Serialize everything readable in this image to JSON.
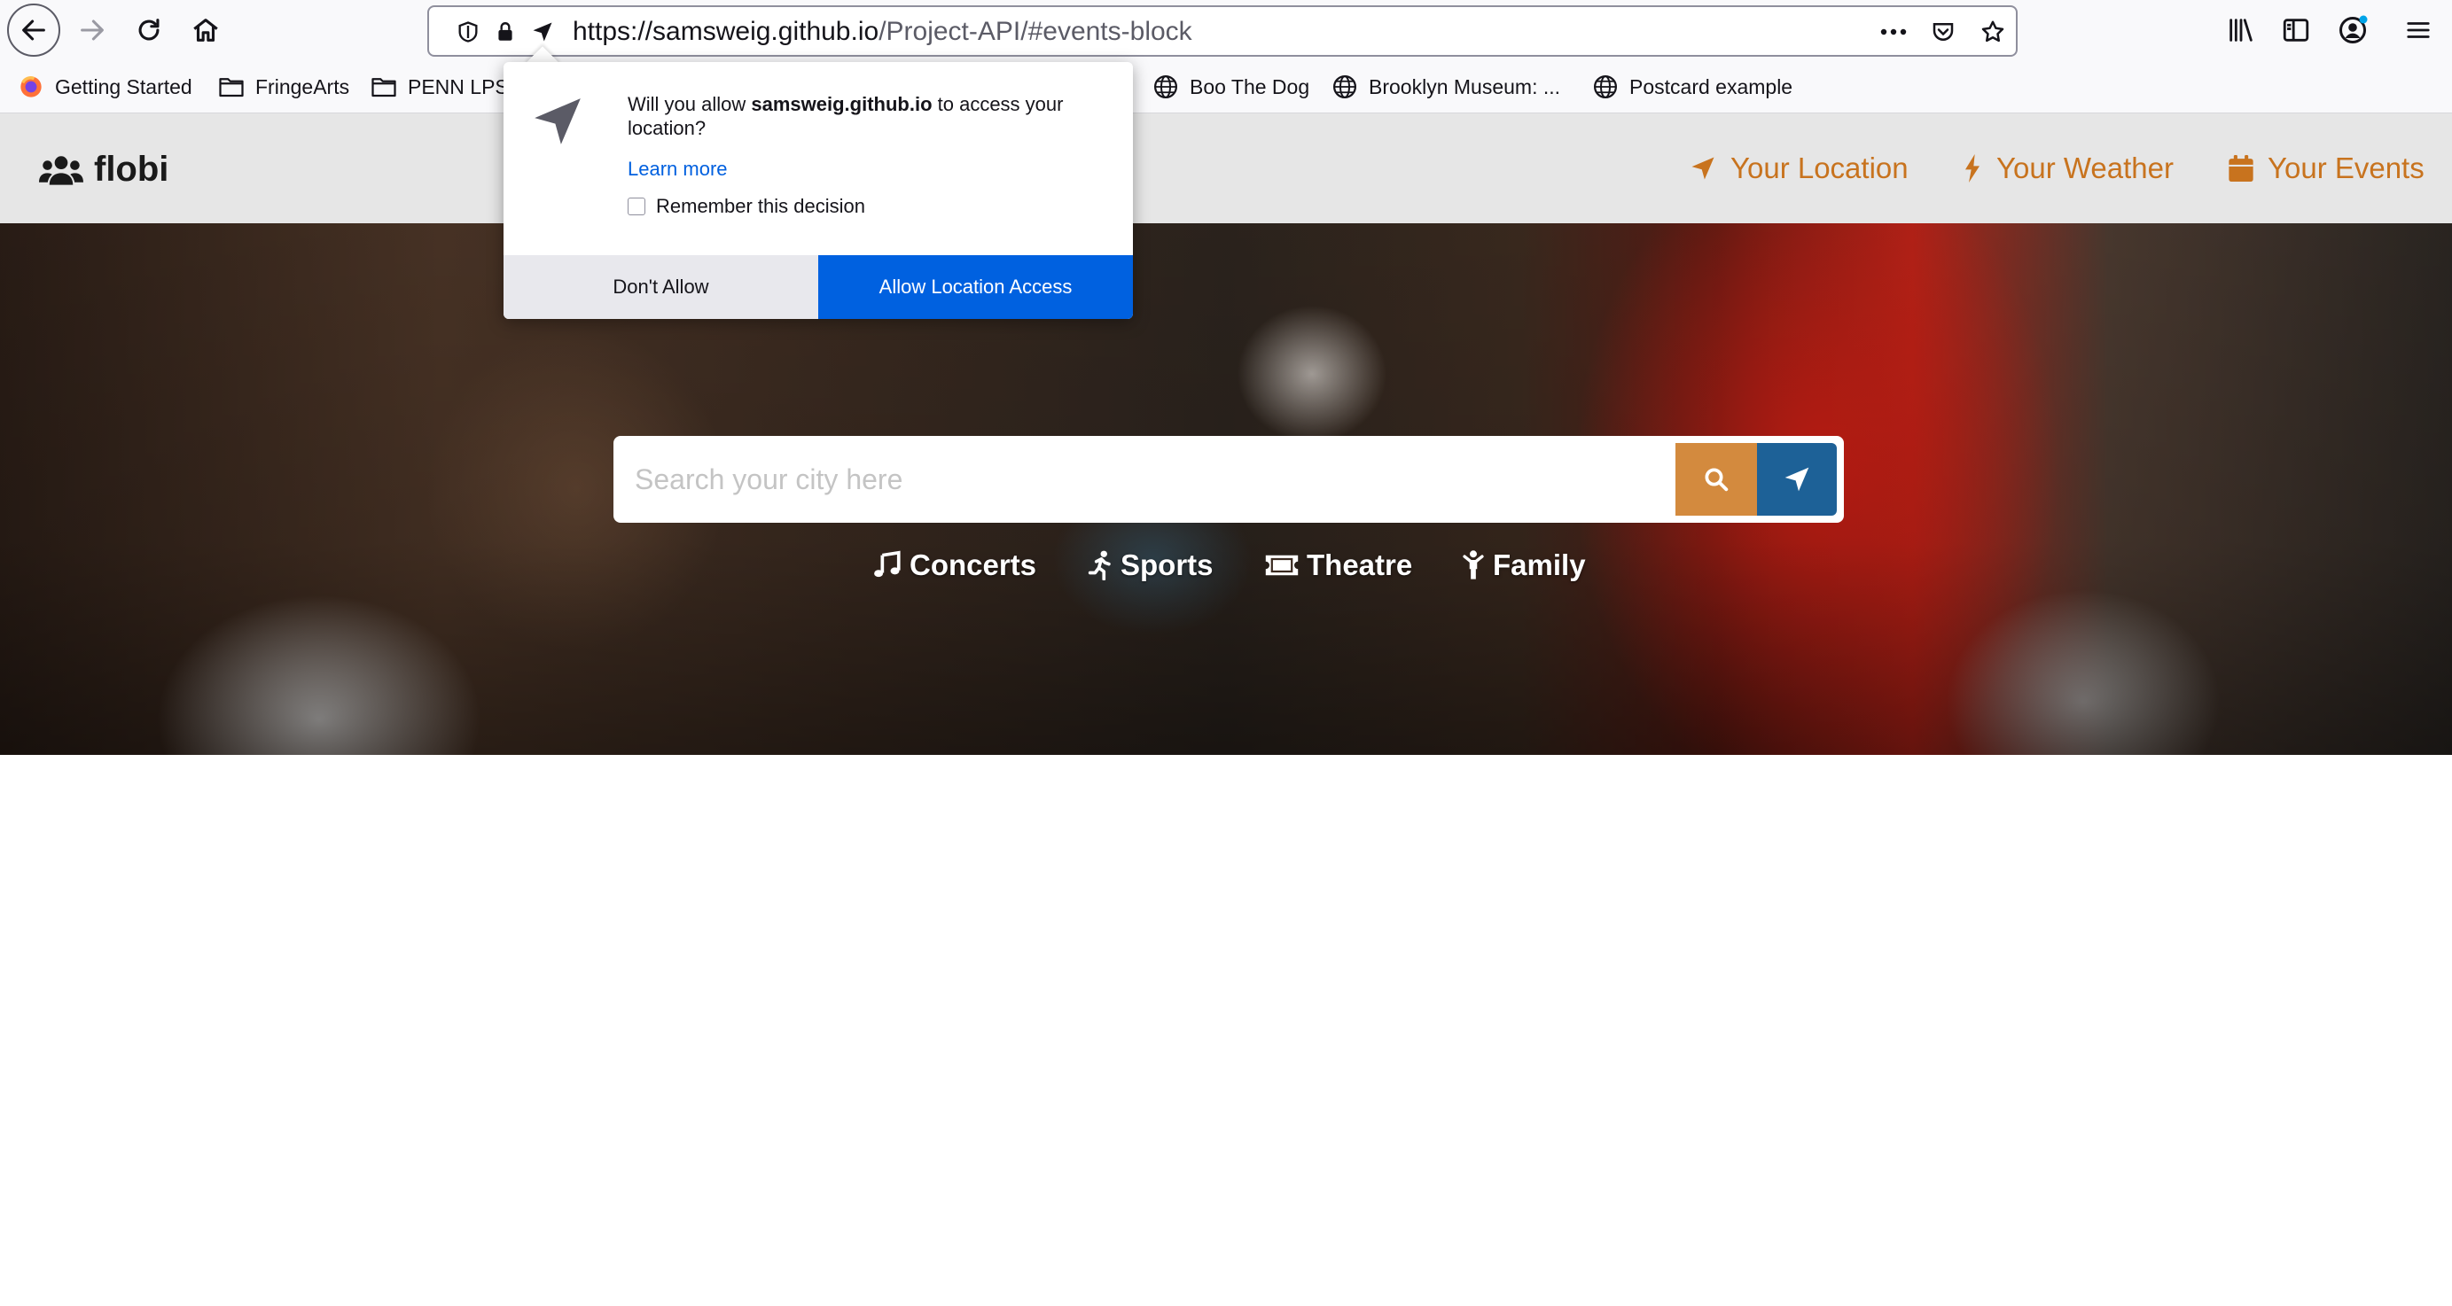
{
  "browser": {
    "url_host": "https://samsweig.github.io",
    "url_path": "/Project-API/#events-block"
  },
  "bookmarks": [
    {
      "label": "Getting Started",
      "icon": "firefox-icon"
    },
    {
      "label": "FringeArts",
      "icon": "folder-icon"
    },
    {
      "label": "PENN LPS",
      "icon": "folder-icon"
    },
    {
      "label": "Boo The Dog",
      "icon": "globe-icon"
    },
    {
      "label": "Brooklyn Museum: ...",
      "icon": "globe-icon"
    },
    {
      "label": "Postcard example",
      "icon": "globe-icon"
    }
  ],
  "site": {
    "brand": "flobi",
    "nav": [
      {
        "label": "Your Location",
        "icon": "location-arrow-icon"
      },
      {
        "label": "Your Weather",
        "icon": "bolt-icon"
      },
      {
        "label": "Your Events",
        "icon": "calendar-icon"
      }
    ],
    "accent": "#c8731e",
    "search_placeholder": "Search your city here",
    "search_button_color": "#d38a3e",
    "locate_button_color": "#1d6197",
    "categories": [
      {
        "label": "Concerts",
        "icon": "music-icon"
      },
      {
        "label": "Sports",
        "icon": "running-icon"
      },
      {
        "label": "Theatre",
        "icon": "ticket-icon"
      },
      {
        "label": "Family",
        "icon": "child-icon"
      }
    ]
  },
  "permission": {
    "message_prefix": "Will you allow ",
    "message_host": "samsweig.github.io",
    "message_suffix": " to access your location?",
    "learn_more": "Learn more",
    "remember": "Remember this decision",
    "deny": "Don't Allow",
    "allow": "Allow Location Access",
    "allow_color": "#0061e0"
  }
}
